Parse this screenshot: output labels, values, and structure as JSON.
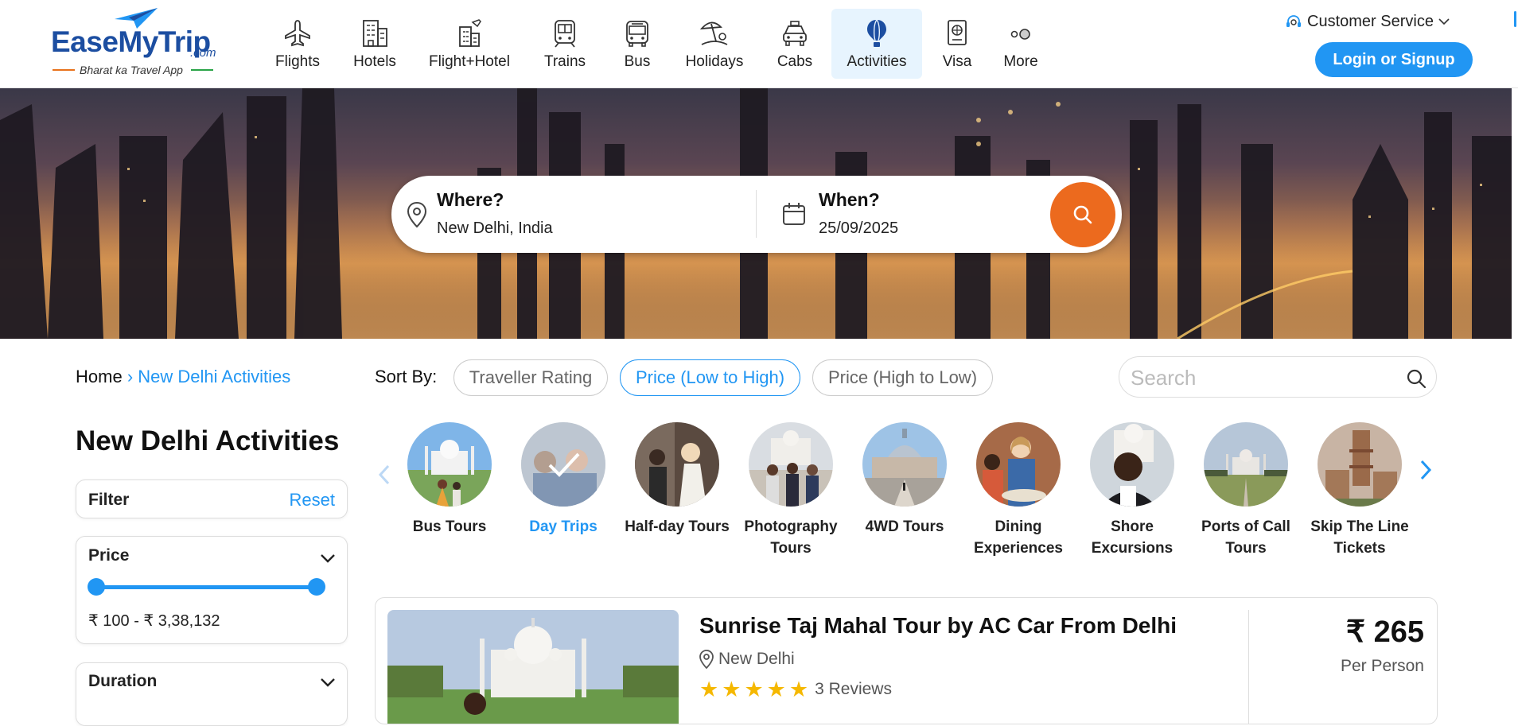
{
  "brand": {
    "name": "EaseMyTrip",
    "suffix": ".com",
    "tagline": "Bharat ka Travel App"
  },
  "nav": [
    {
      "label": "Flights",
      "icon": "plane-icon"
    },
    {
      "label": "Hotels",
      "icon": "hotel-icon"
    },
    {
      "label": "Flight+Hotel",
      "icon": "flight-hotel-icon"
    },
    {
      "label": "Trains",
      "icon": "train-icon"
    },
    {
      "label": "Bus",
      "icon": "bus-icon"
    },
    {
      "label": "Holidays",
      "icon": "holiday-icon"
    },
    {
      "label": "Cabs",
      "icon": "cab-icon"
    },
    {
      "label": "Activities",
      "icon": "balloon-icon",
      "active": true
    },
    {
      "label": "Visa",
      "icon": "passport-icon"
    },
    {
      "label": "More",
      "icon": "more-icon"
    }
  ],
  "header": {
    "customer_service": "Customer Service",
    "login": "Login or Signup"
  },
  "search": {
    "where_label": "Where?",
    "where_value": "New Delhi, India",
    "when_label": "When?",
    "when_value": "25/09/2025"
  },
  "breadcrumb": {
    "home": "Home",
    "separator": "›",
    "current": "New Delhi Activities"
  },
  "page_title": "New Delhi Activities",
  "sort": {
    "label": "Sort By:",
    "options": [
      "Traveller Rating",
      "Price (Low to High)",
      "Price (High to Low)"
    ],
    "selected": "Price (Low to High)"
  },
  "activity_search": {
    "placeholder": "Search"
  },
  "filters": {
    "filter_label": "Filter",
    "reset_label": "Reset",
    "price": {
      "title": "Price",
      "range_text": "₹ 100 - ₹ 3,38,132",
      "min_fraction": 0.0,
      "max_fraction": 1.0
    },
    "duration": {
      "title": "Duration"
    }
  },
  "categories": [
    {
      "label": "Bus Tours"
    },
    {
      "label": "Day Trips",
      "active": true
    },
    {
      "label": "Half-day Tours"
    },
    {
      "label": "Photography Tours"
    },
    {
      "label": "4WD Tours"
    },
    {
      "label": "Dining Experiences"
    },
    {
      "label": "Shore Excursions"
    },
    {
      "label": "Ports of Call Tours"
    },
    {
      "label": "Skip The Line Tickets"
    }
  ],
  "results": [
    {
      "title": "Sunrise Taj Mahal Tour by AC Car From Delhi",
      "location": "New Delhi",
      "rating_stars": 5,
      "reviews": "3 Reviews",
      "price": "₹ 265",
      "price_unit": "Per Person"
    }
  ],
  "colors": {
    "accent": "#2196f3",
    "search_button": "#ec6a1e",
    "brand_blue": "#1c4ea1",
    "star": "#f5b800"
  }
}
